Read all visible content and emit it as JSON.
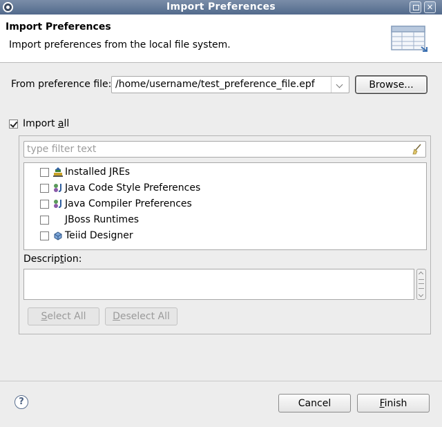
{
  "window": {
    "title": "Import Preferences",
    "max_icon": "maximize-icon",
    "close_icon": "close-icon",
    "close_glyph": "×"
  },
  "header": {
    "title": "Import Preferences",
    "message": "Import preferences from the local file system."
  },
  "file": {
    "label": "From preference file:",
    "value": "/home/username/test_preference_file.epf",
    "browse_label": "Browse..."
  },
  "import_all": {
    "label_pre": "Import ",
    "label_mnemonic": "a",
    "label_post": "ll",
    "checked": true
  },
  "filter": {
    "placeholder": "type filter text"
  },
  "tree": {
    "items": [
      {
        "label": "Installed JREs",
        "icon": "jre-icon",
        "checked": false
      },
      {
        "label": "Java Code Style Preferences",
        "icon": "java-prefs-icon",
        "checked": false
      },
      {
        "label": "Java Compiler Preferences",
        "icon": "java-prefs-icon",
        "checked": false
      },
      {
        "label": "JBoss Runtimes",
        "icon": "",
        "checked": false
      },
      {
        "label": "Teiid Designer",
        "icon": "teiid-icon",
        "checked": false
      }
    ]
  },
  "description": {
    "label_pre": "Descrip",
    "label_mnemonic": "t",
    "label_post": "ion:",
    "value": ""
  },
  "buttons": {
    "select_all_mnemonic": "S",
    "select_all_rest": "elect All",
    "deselect_all_mnemonic": "D",
    "deselect_all_rest": "eselect All",
    "cancel": "Cancel",
    "finish_mnemonic": "F",
    "finish_rest": "inish"
  },
  "footer": {
    "help_glyph": "?"
  },
  "colors": {
    "titlebar": "#526a8c",
    "background": "#ededed"
  }
}
